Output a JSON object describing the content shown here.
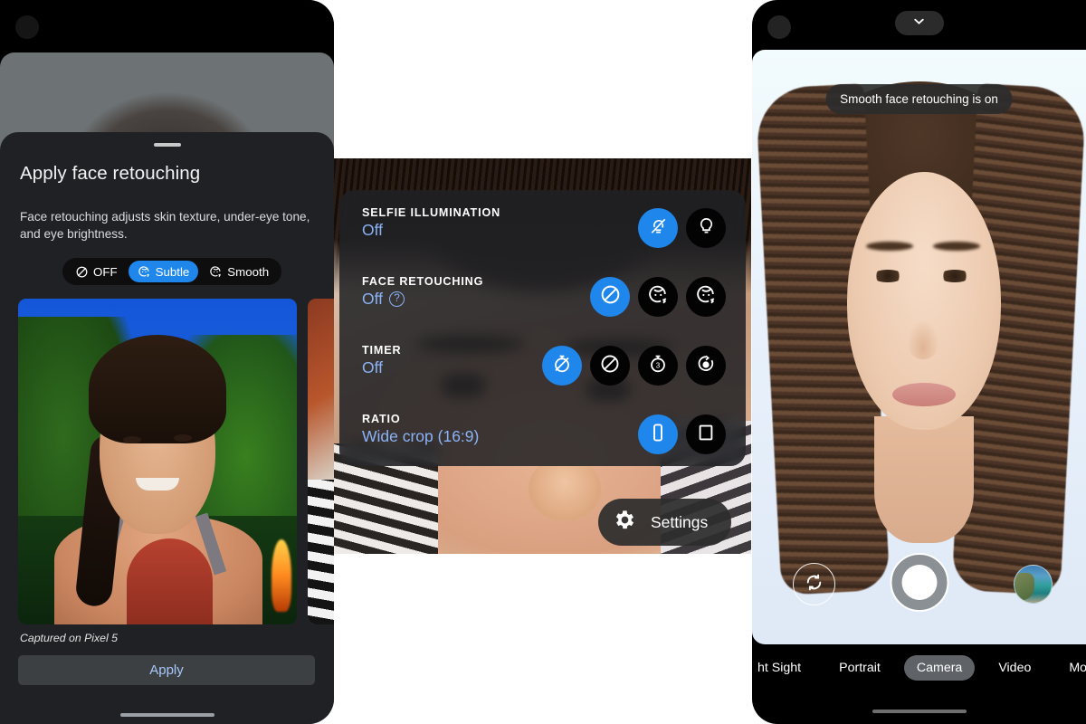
{
  "panel1": {
    "name": "face-retouching-bottom-sheet",
    "title": "Apply face retouching",
    "description": "Face retouching adjusts skin texture, under-eye tone, and eye brightness.",
    "options": [
      {
        "label": "OFF",
        "icon": "face-retouch-off-icon",
        "selected": false
      },
      {
        "label": "Subtle",
        "icon": "face-retouch-subtle-icon",
        "selected": true
      },
      {
        "label": "Smooth",
        "icon": "face-retouch-smooth-icon",
        "selected": false
      }
    ],
    "caption": "Captured on Pixel 5",
    "apply_label": "Apply",
    "accent": "#1f87ec",
    "link_color": "#a8c7fa",
    "sheet_bg": "#202124"
  },
  "panel2": {
    "name": "camera-quick-settings",
    "rows": [
      {
        "label": "SELFIE ILLUMINATION",
        "value": "Off",
        "has_help": false,
        "buttons": [
          {
            "icon": "illumination-off-icon",
            "selected": true
          },
          {
            "icon": "illumination-on-icon",
            "selected": false
          }
        ]
      },
      {
        "label": "FACE RETOUCHING",
        "value": "Off",
        "has_help": true,
        "help_icon": "help-circle-icon",
        "buttons": [
          {
            "icon": "face-retouch-off-icon",
            "selected": true
          },
          {
            "icon": "face-retouch-subtle-icon",
            "selected": false
          },
          {
            "icon": "face-retouch-smooth-icon",
            "selected": false
          }
        ]
      },
      {
        "label": "TIMER",
        "value": "Off",
        "has_help": false,
        "buttons": [
          {
            "icon": "timer-off-icon",
            "selected": true
          },
          {
            "icon": "timer-none-icon",
            "selected": false
          },
          {
            "icon": "timer-3s-icon",
            "selected": false,
            "text": "3"
          },
          {
            "icon": "timer-10s-icon",
            "selected": false
          }
        ]
      },
      {
        "label": "RATIO",
        "value": "Wide crop (16:9)",
        "has_help": false,
        "buttons": [
          {
            "icon": "ratio-wide-icon",
            "selected": true
          },
          {
            "icon": "ratio-full-icon",
            "selected": false
          }
        ]
      }
    ],
    "settings_button": {
      "label": "Settings",
      "icon": "gear-icon"
    },
    "accent": "#1f87ec",
    "value_color": "#8ab4f8"
  },
  "panel3": {
    "name": "camera-viewfinder",
    "chevron_icon": "chevron-down-icon",
    "toast": "Smooth face retouching is on",
    "controls": {
      "flip_icon": "camera-flip-icon",
      "shutter": "shutter-button",
      "thumbnail": "gallery-thumbnail"
    },
    "modes": [
      {
        "label": "ht Sight",
        "active": false
      },
      {
        "label": "Portrait",
        "active": false
      },
      {
        "label": "Camera",
        "active": true
      },
      {
        "label": "Video",
        "active": false
      },
      {
        "label": "More",
        "active": false
      }
    ]
  }
}
